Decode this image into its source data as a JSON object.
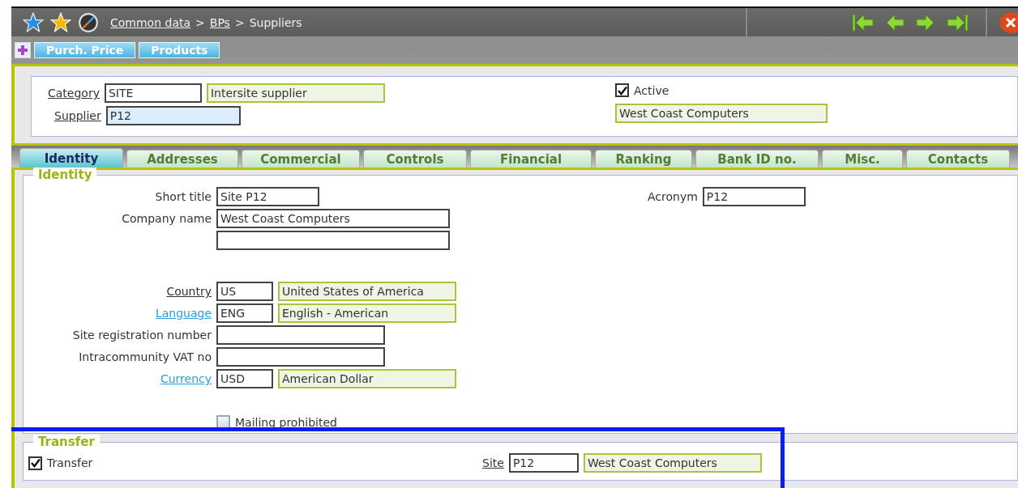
{
  "breadcrumb": [
    {
      "kind": "link",
      "label": "Common data"
    },
    {
      "kind": "separator",
      "label": ">"
    },
    {
      "kind": "link",
      "label": "BPs"
    },
    {
      "kind": "separator",
      "label": ">"
    },
    {
      "kind": "current",
      "label": "Suppliers"
    }
  ],
  "toolbar": {
    "buttons": [
      "Purch. Price",
      "Products"
    ]
  },
  "header": {
    "category": {
      "label": "Category",
      "code": "SITE",
      "description": "Intersite supplier"
    },
    "supplier": {
      "label": "Supplier",
      "code": "P12"
    },
    "active": {
      "label": "Active",
      "checked": true
    },
    "name": "West Coast Computers"
  },
  "tabs": [
    {
      "label": "Identity",
      "selected": true
    },
    {
      "label": "Addresses",
      "selected": false
    },
    {
      "label": "Commercial",
      "selected": false
    },
    {
      "label": "Controls",
      "selected": false
    },
    {
      "label": "Financial",
      "selected": false
    },
    {
      "label": "Ranking",
      "selected": false
    },
    {
      "label": "Bank ID no.",
      "selected": false
    },
    {
      "label": "Misc.",
      "selected": false
    },
    {
      "label": "Contacts",
      "selected": false
    }
  ],
  "identity": {
    "title": "Identity",
    "rows": [
      {
        "kind": "text",
        "label": "Short title",
        "fields": [
          {
            "kind": "short",
            "value": "Site P12"
          }
        ]
      },
      {
        "kind": "text",
        "label": "Company name",
        "fields": [
          {
            "kind": "long",
            "value": "West Coast Computers"
          }
        ]
      },
      {
        "kind": "blank",
        "fields": [
          {
            "kind": "long"
          }
        ]
      },
      {
        "kind": "spacer"
      },
      {
        "kind": "underlined",
        "label": "Country",
        "fields": [
          {
            "kind": "code",
            "value": "US"
          },
          {
            "kind": "display",
            "value": "United States of America"
          }
        ]
      },
      {
        "kind": "link",
        "label": "Language",
        "fields": [
          {
            "kind": "code",
            "value": "ENG"
          },
          {
            "kind": "display",
            "value": "English - American"
          }
        ]
      },
      {
        "kind": "text",
        "label": "Site registration number",
        "fields": [
          {
            "kind": "medium"
          }
        ]
      },
      {
        "kind": "text",
        "label": "Intracommunity VAT no",
        "fields": [
          {
            "kind": "medium"
          }
        ]
      },
      {
        "kind": "link",
        "label": "Currency",
        "fields": [
          {
            "kind": "code",
            "value": "USD"
          },
          {
            "kind": "display",
            "value": "American Dollar"
          }
        ]
      }
    ],
    "acronym": {
      "label": "Acronym",
      "value": "P12"
    },
    "mailing": {
      "label": "Mailing prohibited",
      "checked": false
    }
  },
  "transfer": {
    "title": "Transfer",
    "checkbox": {
      "label": "Transfer",
      "checked": true
    },
    "site": {
      "label": "Site",
      "code": "P12",
      "description": "West Coast Computers"
    }
  }
}
